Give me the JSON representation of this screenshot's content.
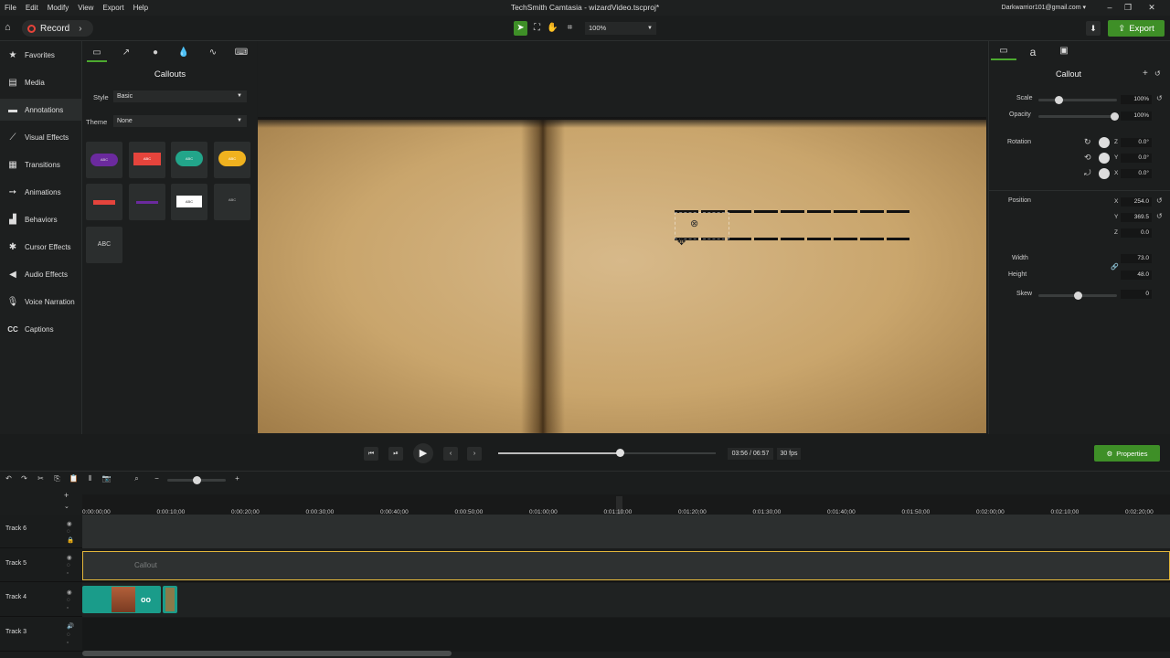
{
  "menu": [
    "File",
    "Edit",
    "Modify",
    "View",
    "Export",
    "Help"
  ],
  "window_title": "TechSmith Camtasia - wizardVideo.tscproj*",
  "account": "Darkwarrior101@gmail.com",
  "toolbar": {
    "record_label": "Record",
    "zoom": "100%",
    "export_label": "Export"
  },
  "nav": [
    {
      "label": "Favorites",
      "icon": "star-icon"
    },
    {
      "label": "Media",
      "icon": "film-icon"
    },
    {
      "label": "Annotations",
      "icon": "annotation-icon"
    },
    {
      "label": "Visual Effects",
      "icon": "wand-icon"
    },
    {
      "label": "Transitions",
      "icon": "transition-icon"
    },
    {
      "label": "Animations",
      "icon": "animation-icon"
    },
    {
      "label": "Behaviors",
      "icon": "behavior-icon"
    },
    {
      "label": "Cursor Effects",
      "icon": "cursor-icon"
    },
    {
      "label": "Audio Effects",
      "icon": "audio-icon"
    },
    {
      "label": "Voice Narration",
      "icon": "mic-icon"
    },
    {
      "label": "Captions",
      "icon": "cc-icon"
    }
  ],
  "callouts": {
    "title": "Callouts",
    "style_label": "Style",
    "style_value": "Basic",
    "theme_label": "Theme",
    "theme_value": "None",
    "tile_text": "ABC",
    "tile_last": "ABC"
  },
  "properties": {
    "title": "Callout",
    "scale_label": "Scale",
    "scale_value": "100%",
    "scale_level": 0.24,
    "opacity_label": "Opacity",
    "opacity_value": "100%",
    "opacity_level": 1.0,
    "rotation_label": "Rotation",
    "rot_z": "0.0°",
    "rot_y": "0.0°",
    "rot_x": "0.0°",
    "position_label": "Position",
    "pos_x": "254.0",
    "pos_y": "369.5",
    "pos_z": "0.0",
    "width_label": "Width",
    "width_value": "73.0",
    "height_label": "Height",
    "height_value": "48.0",
    "skew_label": "Skew",
    "skew_value": "0",
    "skew_level": 0.5,
    "axis_x": "X",
    "axis_y": "Y",
    "axis_z": "Z"
  },
  "playback": {
    "time": "03:56 / 06:57",
    "fps": "30 fps",
    "progress": 0.56,
    "properties_label": "Properties"
  },
  "timeline": {
    "ticks": [
      "0:00:00;00",
      "0:00:10;00",
      "0:00:20;00",
      "0:00:30;00",
      "0:00:40;00",
      "0:00:50;00",
      "0:01:00;00",
      "0:01:10;00",
      "0:01:20;00",
      "0:01:30;00",
      "0:01:40;00",
      "0:01:50;00",
      "0:02:00;00",
      "0:02:10;00",
      "0:02:20;00"
    ],
    "tracks": [
      "Track 6",
      "Track 5",
      "Track 4",
      "Track 3"
    ],
    "callout_clip": "Callout",
    "clip_text": "oo"
  },
  "colors": {
    "accent": "#3e8f27",
    "record": "#e8443a",
    "clip_teal": "#1a9c8a",
    "callout_lane": "#e3b63a"
  }
}
